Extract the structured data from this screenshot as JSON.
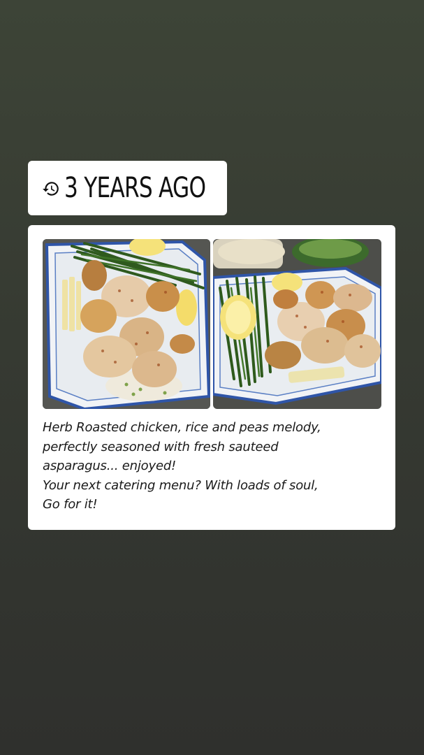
{
  "memory_sticker": {
    "label": "3 YEARS AGO",
    "icon": "history-icon"
  },
  "post": {
    "photos": [
      {
        "name": "food-photo-left",
        "subject": "roasted chicken with rice and asparagus on platter"
      },
      {
        "name": "food-photo-right",
        "subject": "roasted chicken with asparagus and lemon on platter"
      }
    ],
    "caption": "Herb Roasted chicken, rice and peas melody,\nperfectly  seasoned with fresh sauteed\nasparagus... enjoyed!\nYour next  catering menu?  With loads of soul,\nGo for it!"
  },
  "colors": {
    "background_top": "#3d4437",
    "background_bottom": "#2f302d",
    "card": "#ffffff",
    "text": "#1a1a1a"
  }
}
